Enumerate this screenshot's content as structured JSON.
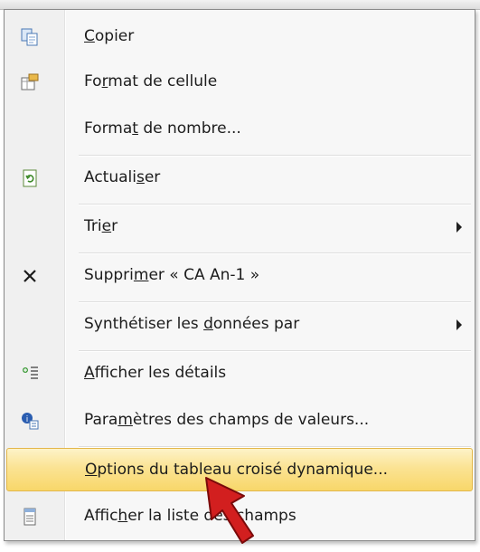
{
  "menu": {
    "items": [
      {
        "pre": "",
        "key": "C",
        "post": "opier",
        "icon": "copy-icon",
        "submenu": false
      },
      {
        "pre": "Fo",
        "key": "r",
        "post": "mat de cellule",
        "icon": "format-cells-icon",
        "submenu": false
      },
      {
        "pre": "Forma",
        "key": "t",
        "post": " de nombre...",
        "icon": "",
        "submenu": false
      },
      {
        "pre": "Actuali",
        "key": "s",
        "post": "er",
        "icon": "refresh-icon",
        "submenu": false
      },
      {
        "pre": "Tri",
        "key": "e",
        "post": "r",
        "icon": "",
        "submenu": true
      },
      {
        "pre": "Suppri",
        "key": "m",
        "post": "er « CA An-1 »",
        "icon": "delete-icon",
        "submenu": false
      },
      {
        "pre": "Synthétiser les ",
        "key": "d",
        "post": "onnées par",
        "icon": "",
        "submenu": true
      },
      {
        "pre": "",
        "key": "A",
        "post": "fficher les détails",
        "icon": "show-details-icon",
        "submenu": false
      },
      {
        "pre": "Para",
        "key": "m",
        "post": "ètres des champs de valeurs...",
        "icon": "field-settings-icon",
        "submenu": false
      },
      {
        "pre": "",
        "key": "O",
        "post": "ptions du tableau croisé dynamique...",
        "icon": "",
        "submenu": false,
        "highlighted": true
      },
      {
        "pre": "Affic",
        "key": "h",
        "post": "er la liste des champs",
        "icon": "field-list-icon",
        "submenu": false
      }
    ]
  },
  "colors": {
    "highlight_top": "#fdf3c8",
    "highlight_bottom": "#f8d76a",
    "highlight_border": "#e3b74a",
    "cursor_red": "#d21f1f"
  }
}
